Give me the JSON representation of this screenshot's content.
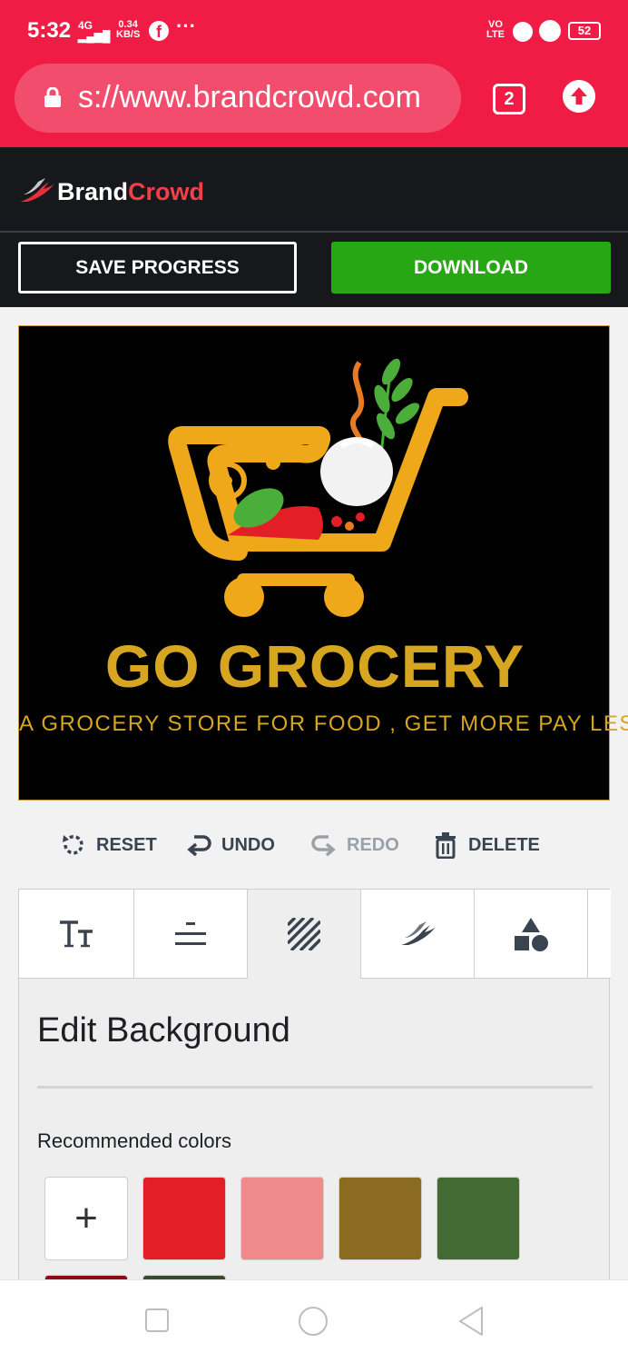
{
  "status_bar": {
    "time": "5:32",
    "network": "4G",
    "speed_value": "0.34",
    "speed_unit": "KB/S",
    "more": "···",
    "volte_top": "VO",
    "volte_bottom": "LTE",
    "battery": "52"
  },
  "browser": {
    "url": "s://www.brandcrowd.com",
    "tab_count": "2"
  },
  "brand": {
    "name_part1": "Brand",
    "name_part2": "Crowd",
    "accent": "#f0404a"
  },
  "actions": {
    "save_label": "SAVE PROGRESS",
    "download_label": "DOWNLOAD",
    "download_color": "#27a713"
  },
  "logo": {
    "title": "GO GROCERY",
    "tagline": "A GROCERY STORE FOR FOOD , GET MORE PAY LESS",
    "text_color": "#d7a620",
    "background": "#000000"
  },
  "toolbar": {
    "reset": "RESET",
    "undo": "UNDO",
    "redo": "REDO",
    "delete": "DELETE"
  },
  "editor_tabs": [
    {
      "icon": "text-size-icon"
    },
    {
      "icon": "align-center-icon"
    },
    {
      "icon": "background-stripes-icon"
    },
    {
      "icon": "brand-logo-icon"
    },
    {
      "icon": "shapes-icon"
    }
  ],
  "panel": {
    "title": "Edit Background",
    "recommended_label": "Recommended colors",
    "add_symbol": "+",
    "colors": [
      "#e41e26",
      "#f08a8a",
      "#8b6b20",
      "#456b34"
    ],
    "next_row_colors": [
      "#8e0a14",
      "#3a4a30"
    ]
  }
}
